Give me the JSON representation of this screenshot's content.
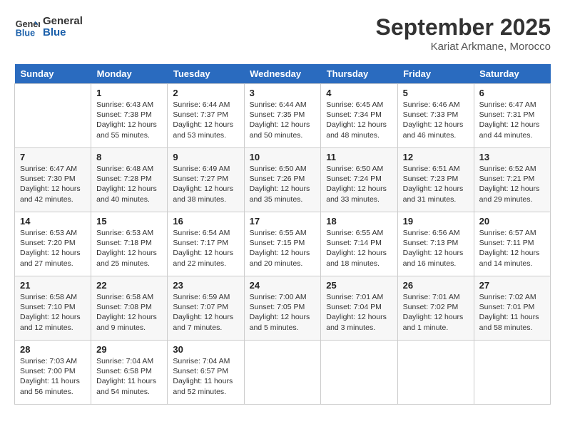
{
  "header": {
    "logo_general": "General",
    "logo_blue": "Blue",
    "month": "September 2025",
    "location": "Kariat Arkmane, Morocco"
  },
  "days_of_week": [
    "Sunday",
    "Monday",
    "Tuesday",
    "Wednesday",
    "Thursday",
    "Friday",
    "Saturday"
  ],
  "weeks": [
    [
      {
        "day": "",
        "info": ""
      },
      {
        "day": "1",
        "info": "Sunrise: 6:43 AM\nSunset: 7:38 PM\nDaylight: 12 hours\nand 55 minutes."
      },
      {
        "day": "2",
        "info": "Sunrise: 6:44 AM\nSunset: 7:37 PM\nDaylight: 12 hours\nand 53 minutes."
      },
      {
        "day": "3",
        "info": "Sunrise: 6:44 AM\nSunset: 7:35 PM\nDaylight: 12 hours\nand 50 minutes."
      },
      {
        "day": "4",
        "info": "Sunrise: 6:45 AM\nSunset: 7:34 PM\nDaylight: 12 hours\nand 48 minutes."
      },
      {
        "day": "5",
        "info": "Sunrise: 6:46 AM\nSunset: 7:33 PM\nDaylight: 12 hours\nand 46 minutes."
      },
      {
        "day": "6",
        "info": "Sunrise: 6:47 AM\nSunset: 7:31 PM\nDaylight: 12 hours\nand 44 minutes."
      }
    ],
    [
      {
        "day": "7",
        "info": "Sunrise: 6:47 AM\nSunset: 7:30 PM\nDaylight: 12 hours\nand 42 minutes."
      },
      {
        "day": "8",
        "info": "Sunrise: 6:48 AM\nSunset: 7:28 PM\nDaylight: 12 hours\nand 40 minutes."
      },
      {
        "day": "9",
        "info": "Sunrise: 6:49 AM\nSunset: 7:27 PM\nDaylight: 12 hours\nand 38 minutes."
      },
      {
        "day": "10",
        "info": "Sunrise: 6:50 AM\nSunset: 7:26 PM\nDaylight: 12 hours\nand 35 minutes."
      },
      {
        "day": "11",
        "info": "Sunrise: 6:50 AM\nSunset: 7:24 PM\nDaylight: 12 hours\nand 33 minutes."
      },
      {
        "day": "12",
        "info": "Sunrise: 6:51 AM\nSunset: 7:23 PM\nDaylight: 12 hours\nand 31 minutes."
      },
      {
        "day": "13",
        "info": "Sunrise: 6:52 AM\nSunset: 7:21 PM\nDaylight: 12 hours\nand 29 minutes."
      }
    ],
    [
      {
        "day": "14",
        "info": "Sunrise: 6:53 AM\nSunset: 7:20 PM\nDaylight: 12 hours\nand 27 minutes."
      },
      {
        "day": "15",
        "info": "Sunrise: 6:53 AM\nSunset: 7:18 PM\nDaylight: 12 hours\nand 25 minutes."
      },
      {
        "day": "16",
        "info": "Sunrise: 6:54 AM\nSunset: 7:17 PM\nDaylight: 12 hours\nand 22 minutes."
      },
      {
        "day": "17",
        "info": "Sunrise: 6:55 AM\nSunset: 7:15 PM\nDaylight: 12 hours\nand 20 minutes."
      },
      {
        "day": "18",
        "info": "Sunrise: 6:55 AM\nSunset: 7:14 PM\nDaylight: 12 hours\nand 18 minutes."
      },
      {
        "day": "19",
        "info": "Sunrise: 6:56 AM\nSunset: 7:13 PM\nDaylight: 12 hours\nand 16 minutes."
      },
      {
        "day": "20",
        "info": "Sunrise: 6:57 AM\nSunset: 7:11 PM\nDaylight: 12 hours\nand 14 minutes."
      }
    ],
    [
      {
        "day": "21",
        "info": "Sunrise: 6:58 AM\nSunset: 7:10 PM\nDaylight: 12 hours\nand 12 minutes."
      },
      {
        "day": "22",
        "info": "Sunrise: 6:58 AM\nSunset: 7:08 PM\nDaylight: 12 hours\nand 9 minutes."
      },
      {
        "day": "23",
        "info": "Sunrise: 6:59 AM\nSunset: 7:07 PM\nDaylight: 12 hours\nand 7 minutes."
      },
      {
        "day": "24",
        "info": "Sunrise: 7:00 AM\nSunset: 7:05 PM\nDaylight: 12 hours\nand 5 minutes."
      },
      {
        "day": "25",
        "info": "Sunrise: 7:01 AM\nSunset: 7:04 PM\nDaylight: 12 hours\nand 3 minutes."
      },
      {
        "day": "26",
        "info": "Sunrise: 7:01 AM\nSunset: 7:02 PM\nDaylight: 12 hours\nand 1 minute."
      },
      {
        "day": "27",
        "info": "Sunrise: 7:02 AM\nSunset: 7:01 PM\nDaylight: 11 hours\nand 58 minutes."
      }
    ],
    [
      {
        "day": "28",
        "info": "Sunrise: 7:03 AM\nSunset: 7:00 PM\nDaylight: 11 hours\nand 56 minutes."
      },
      {
        "day": "29",
        "info": "Sunrise: 7:04 AM\nSunset: 6:58 PM\nDaylight: 11 hours\nand 54 minutes."
      },
      {
        "day": "30",
        "info": "Sunrise: 7:04 AM\nSunset: 6:57 PM\nDaylight: 11 hours\nand 52 minutes."
      },
      {
        "day": "",
        "info": ""
      },
      {
        "day": "",
        "info": ""
      },
      {
        "day": "",
        "info": ""
      },
      {
        "day": "",
        "info": ""
      }
    ]
  ]
}
